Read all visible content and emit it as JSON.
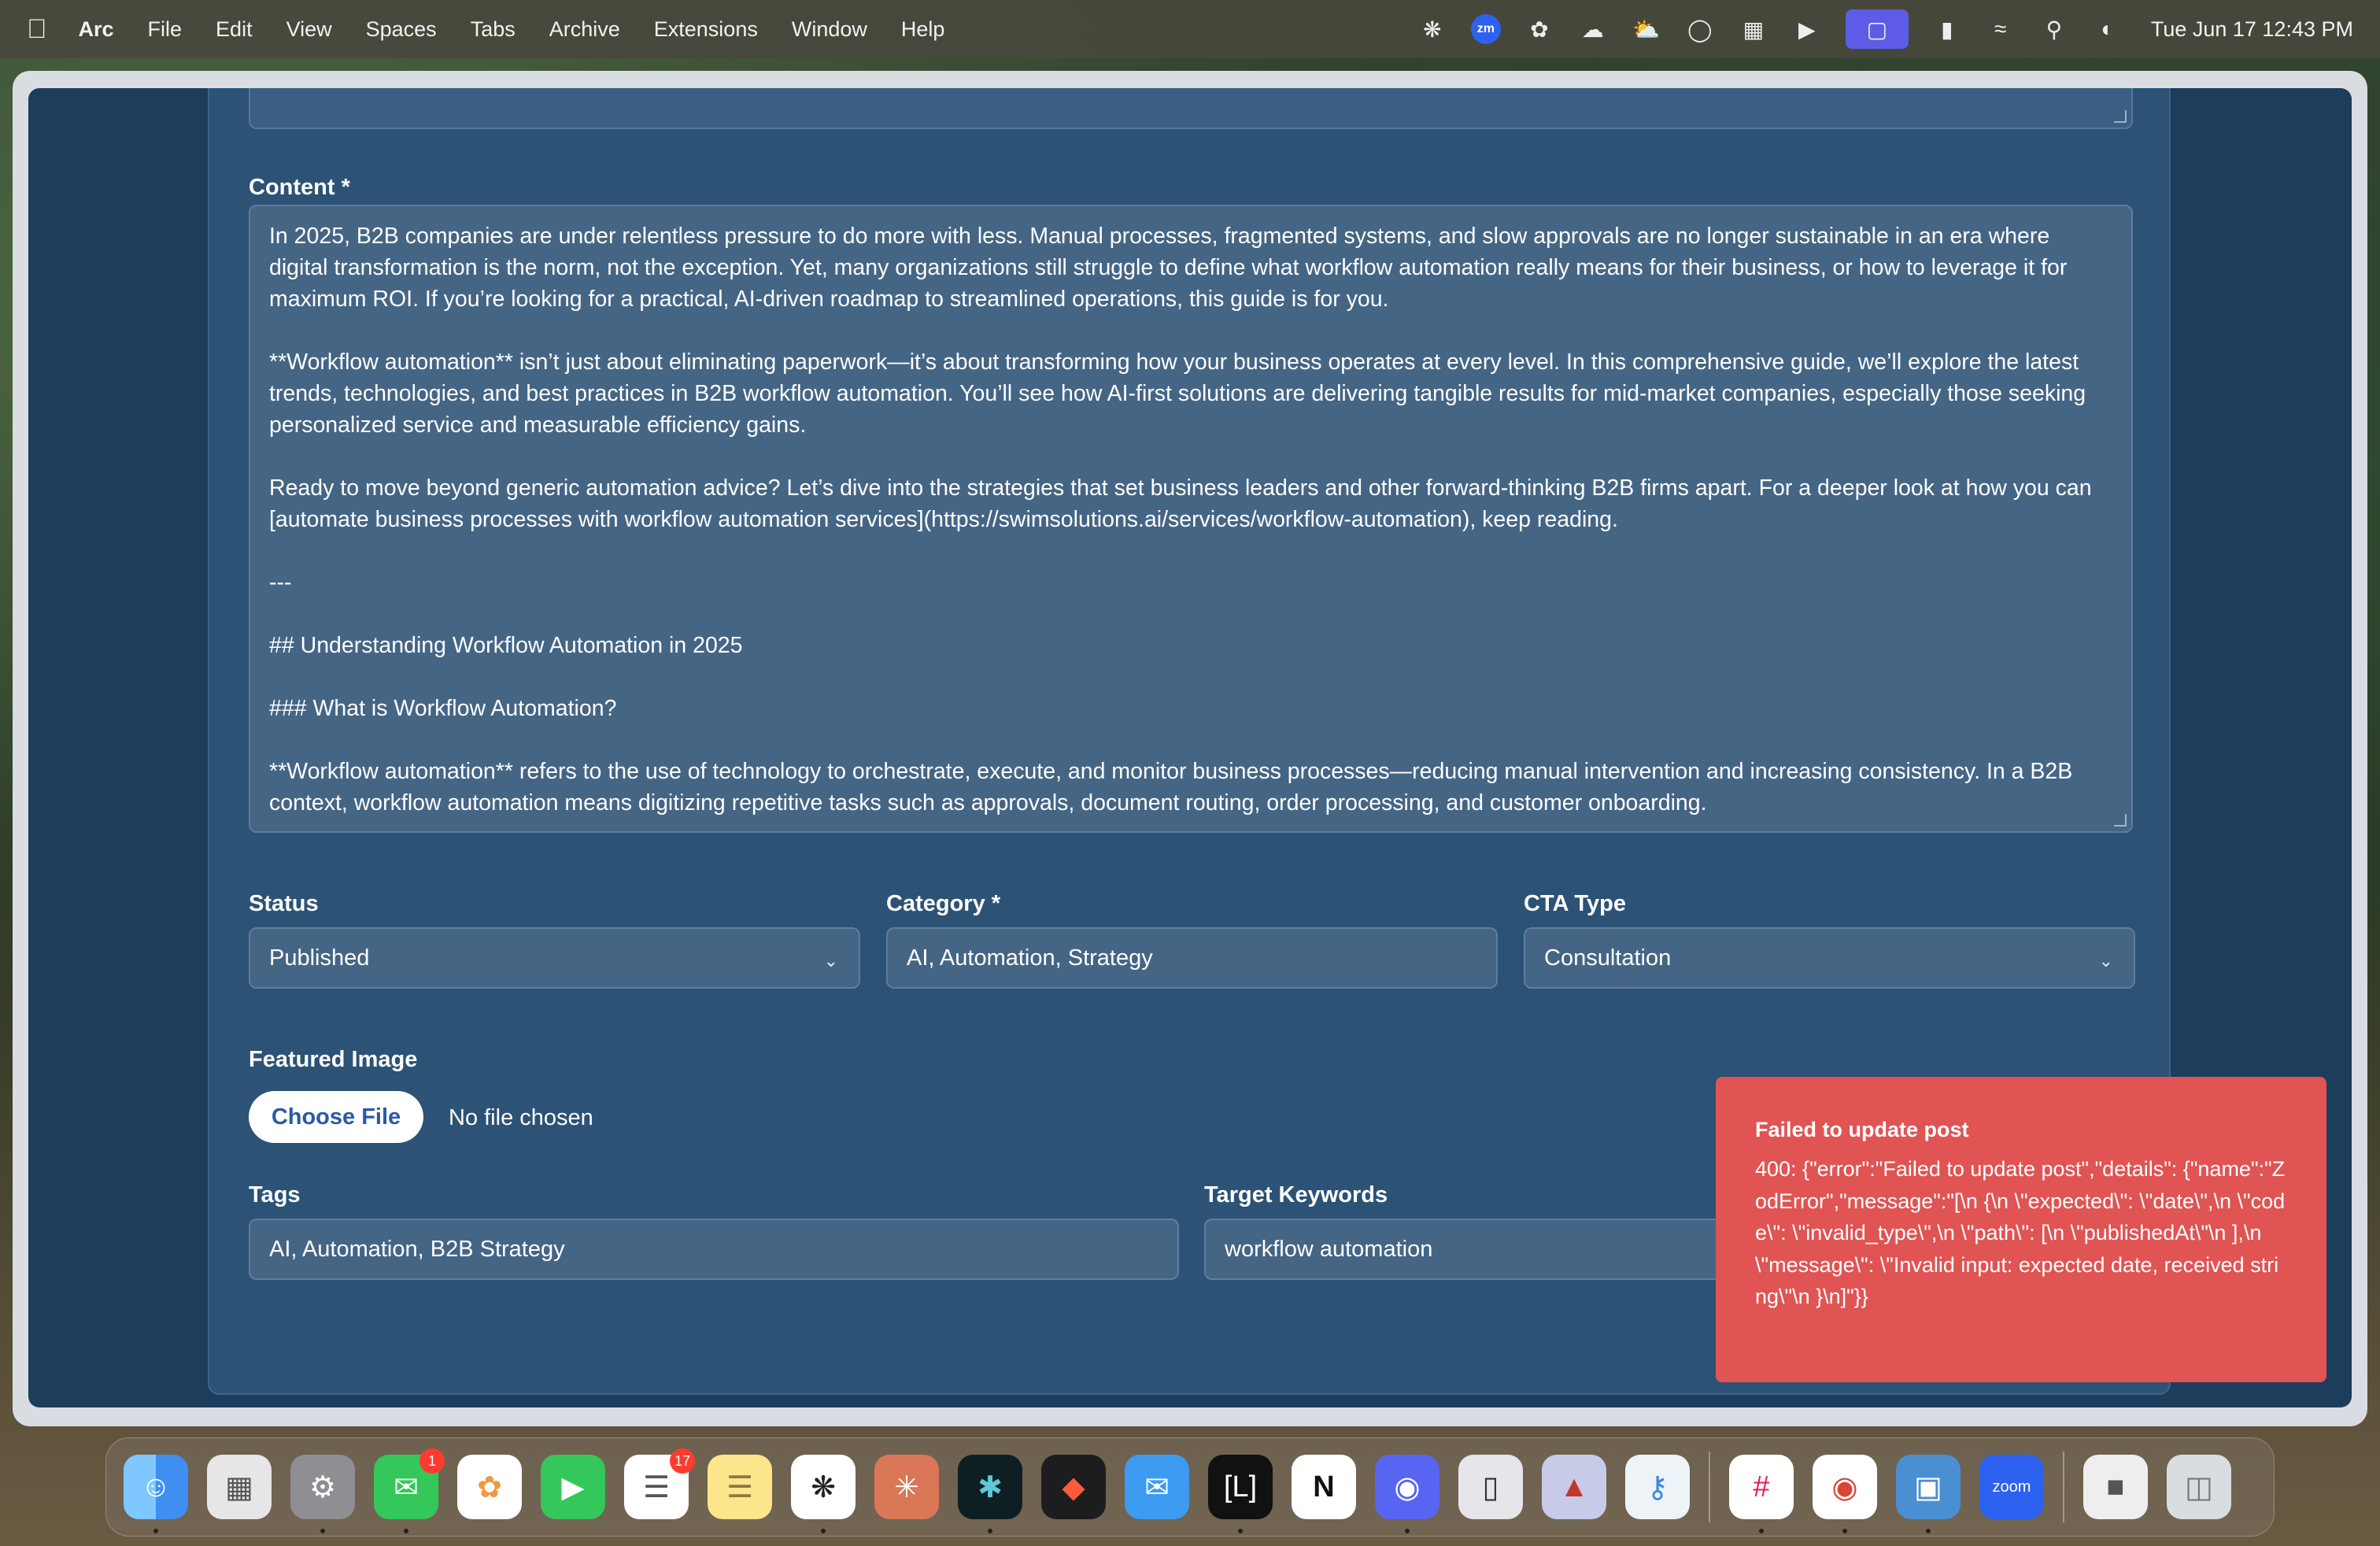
{
  "menubar": {
    "app_name": "Arc",
    "items": [
      "File",
      "Edit",
      "View",
      "Spaces",
      "Tabs",
      "Archive",
      "Extensions",
      "Window",
      "Help"
    ],
    "zoom_icon_text": "zm",
    "clock": "Tue Jun 17  12:43 PM"
  },
  "form": {
    "content_label": "Content *",
    "content_paragraphs": [
      "In 2025, B2B companies are under relentless pressure to do more with less. Manual processes, fragmented systems, and slow approvals are no longer sustainable in an era where digital transformation is the norm, not the exception. Yet, many organizations still struggle to define what workflow automation really means for their business, or how to leverage it for maximum ROI. If you’re looking for a practical, AI-driven roadmap to streamlined operations, this guide is for you.",
      "**Workflow automation** isn’t just about eliminating paperwork—it’s about transforming how your business operates at every level. In this comprehensive guide, we’ll explore the latest trends, technologies, and best practices in B2B workflow automation. You’ll see how AI-first solutions are delivering tangible results for mid-market companies, especially those seeking personalized service and measurable efficiency gains.",
      "Ready to move beyond generic automation advice? Let’s dive into the strategies that set business leaders and other forward-thinking B2B firms apart. For a deeper look at how you can [automate business processes with workflow automation services](https://swimsolutions.ai/services/workflow-automation), keep reading.",
      "---",
      "## Understanding Workflow Automation in 2025",
      "### What is Workflow Automation?",
      "**Workflow automation** refers to the use of technology to orchestrate, execute, and monitor business processes—reducing manual intervention and increasing consistency. In a B2B context, workflow automation means digitizing repetitive tasks such as approvals, document routing, order processing, and customer onboarding."
    ],
    "status_label": "Status",
    "status_value": "Published",
    "category_label": "Category *",
    "category_value": "AI, Automation, Strategy",
    "cta_label": "CTA Type",
    "cta_value": "Consultation",
    "featured_image_label": "Featured Image",
    "choose_file_label": "Choose File",
    "no_file_text": "No file chosen",
    "tags_label": "Tags",
    "tags_value": "AI, Automation, B2B Strategy",
    "keywords_label": "Target Keywords",
    "keywords_value": "workflow automation"
  },
  "toast": {
    "title": "Failed to update post",
    "message": "400: {\"error\":\"Failed to update post\",\"details\": {\"name\":\"ZodError\",\"message\":\"[\\n {\\n \\\"expected\\\": \\\"date\\\",\\n \\\"code\\\": \\\"invalid_type\\\",\\n \\\"path\\\": [\\n \\\"publishedAt\\\"\\n ],\\n \\\"message\\\": \\\"Invalid input: expected date, received string\\\"\\n }\\n]\"}}",
    "color": "#e05454"
  },
  "dock": {
    "messages_badge": "1",
    "reminders_badge": "17",
    "zoom_label": "zoom",
    "apps": [
      "Finder",
      "Launchpad",
      "System Settings",
      "Messages",
      "Photos",
      "FaceTime",
      "Reminders",
      "Notes",
      "ChatGPT",
      "Claude",
      "Perplexity",
      "Raycast",
      "Airmail",
      "Linear",
      "Notion",
      "Discord",
      "iPhone Mirroring",
      "Affinity",
      "Passwords",
      "Slack",
      "Chrome",
      "Screen",
      "Zoom",
      "Archive Utility",
      "Trash"
    ]
  },
  "colors": {
    "page_bg": "#1c3d5c",
    "card_bg": "#2c5275",
    "input_bg": "#456585",
    "accent": "#2a5aa6"
  }
}
